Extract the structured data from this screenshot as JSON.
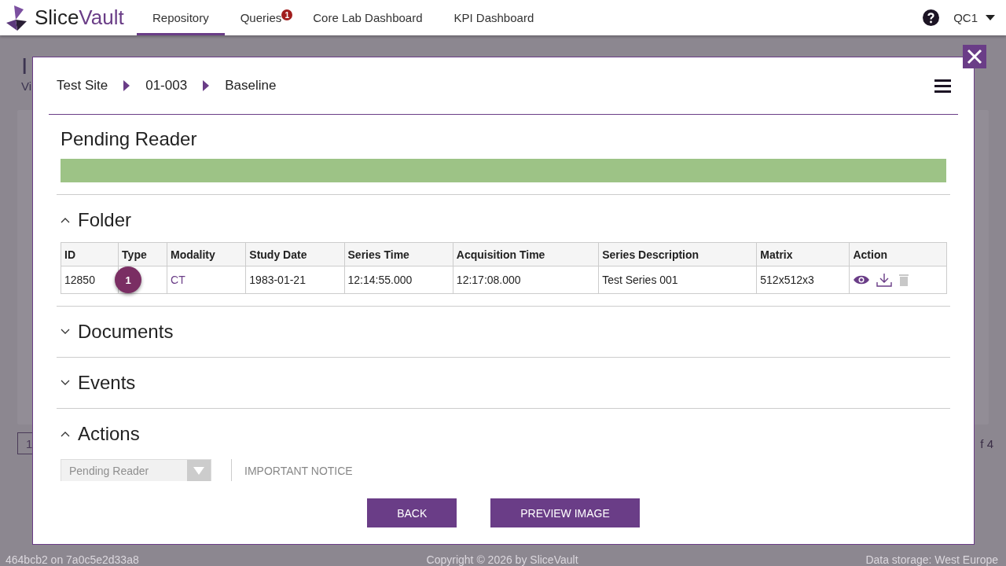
{
  "app": {
    "logo": {
      "first": "Slice",
      "second": "Vault"
    },
    "nav": [
      {
        "label": "Repository",
        "selected": true
      },
      {
        "label": "Queries",
        "selected": false,
        "badge": "1"
      },
      {
        "label": "Core Lab Dashboard",
        "selected": false
      },
      {
        "label": "KPI Dashboard",
        "selected": false
      }
    ],
    "user": "QC1"
  },
  "background": {
    "title": "I",
    "subtitle": "Vi",
    "page": "1",
    "page_count": "f 4"
  },
  "footer": {
    "build": "464bcb2 on 7a0c5e2d33a8",
    "copyright": "Copyright © 2026 by SliceVault",
    "storage": "Data storage: West Europe"
  },
  "modal": {
    "breadcrumb": [
      "Test Site",
      "01-003",
      "Baseline"
    ],
    "status_title": "Pending Reader",
    "progress": {
      "level": 1
    },
    "sections": [
      {
        "title": "Folder",
        "kind": "table",
        "expanded": true
      },
      {
        "title": "Documents",
        "expanded": false
      },
      {
        "title": "Events",
        "expanded": false
      },
      {
        "title": "Actions",
        "kind": "actions",
        "expanded": true
      }
    ],
    "table": {
      "columns": [
        "ID",
        "Type",
        "Modality",
        "Study Date",
        "Series Time",
        "Acquisition Time",
        "Series Description",
        "Matrix",
        "Action"
      ],
      "rows": [
        {
          "id": "12850",
          "type_badge": "1",
          "modality": "CT",
          "study_date": "1983-01-21",
          "series_time": "12:14:55.000",
          "acquisition_time": "12:17:08.000",
          "series_description": "Test Series 001",
          "matrix": "512x512x3",
          "actions": [
            {
              "kind": "view",
              "disabled": false
            },
            {
              "kind": "download",
              "disabled": false
            },
            {
              "kind": "delete",
              "disabled": true
            }
          ]
        }
      ]
    },
    "actions": {
      "select": {
        "value": "Pending Reader",
        "disabled": true
      },
      "notice_title": "IMPORTANT NOTICE"
    },
    "buttons": [
      "BACK",
      "PREVIEW IMAGE"
    ]
  }
}
